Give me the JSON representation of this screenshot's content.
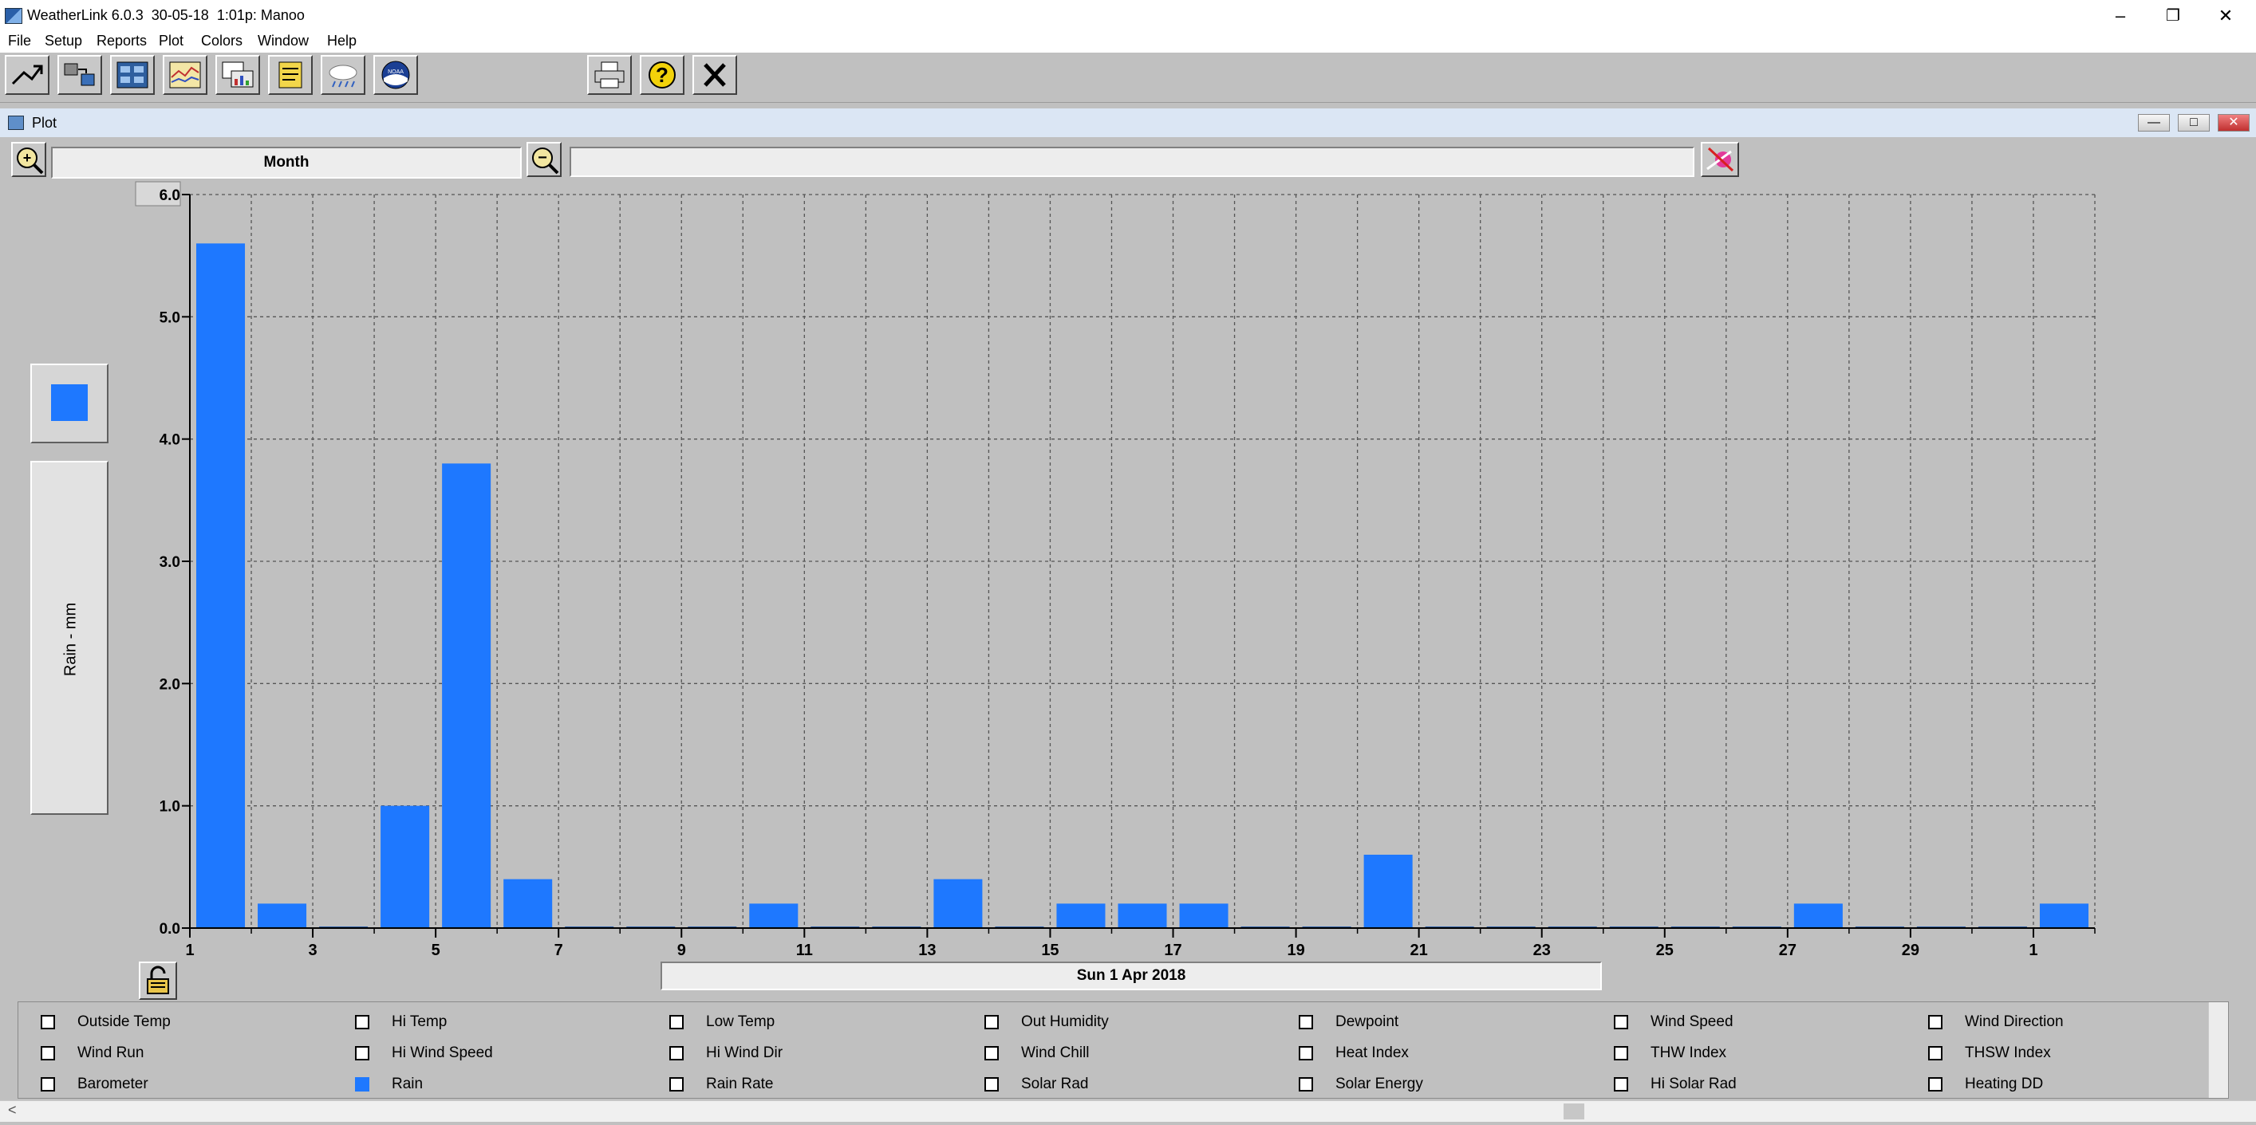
{
  "window": {
    "title": "WeatherLink 6.0.3  30-05-18  1:01p: Manoo",
    "minimize": "–",
    "restore": "❐",
    "close": "✕"
  },
  "menu": [
    "File",
    "Setup",
    "Reports",
    "Plot",
    "Colors",
    "Window",
    "Help"
  ],
  "toolbar": {
    "icons": [
      "station-icon",
      "transfer-icon",
      "bulletin-icon",
      "strip-chart-icon",
      "plot-icon",
      "notes-icon",
      "weather-icon",
      "noaa-icon",
      "print-icon",
      "help-icon",
      "close-icon"
    ],
    "noaa_text": "NOAA",
    "help_glyph": "?",
    "close_glyph": "✕"
  },
  "plot_window": {
    "title": "Plot",
    "controls": [
      "—",
      "□",
      "✕"
    ]
  },
  "plot_header": {
    "range_label": "Month",
    "zoom_in": "+",
    "zoom_out": "−"
  },
  "y_axis_box": {
    "label": "Rain - mm"
  },
  "date_label": "Sun 1 Apr 2018",
  "colors": {
    "bar": "#1e78ff",
    "background": "#c0c0c0"
  },
  "chart_data": {
    "type": "bar",
    "ylabel": "Rain - mm",
    "ylim": [
      0,
      6
    ],
    "yticks": [
      "0.0",
      "1.0",
      "2.0",
      "3.0",
      "4.0",
      "5.0",
      "6.0"
    ],
    "xtick_labels": [
      "1",
      "3",
      "5",
      "7",
      "9",
      "11",
      "13",
      "15",
      "17",
      "19",
      "21",
      "23",
      "25",
      "27",
      "29",
      "1"
    ],
    "categories": [
      "1",
      "2",
      "3",
      "4",
      "5",
      "6",
      "7",
      "8",
      "9",
      "10",
      "11",
      "12",
      "13",
      "14",
      "15",
      "16",
      "17",
      "18",
      "19",
      "20",
      "21",
      "22",
      "23",
      "24",
      "25",
      "26",
      "27",
      "28",
      "29",
      "30",
      "1"
    ],
    "values": [
      5.6,
      0.2,
      0,
      1.0,
      3.8,
      0.4,
      0,
      0,
      0,
      0.2,
      0,
      0,
      0.4,
      0,
      0.2,
      0.2,
      0.2,
      0,
      0,
      0.6,
      0,
      0,
      0,
      0,
      0,
      0,
      0.2,
      0,
      0,
      0,
      0.2
    ],
    "grid": true
  },
  "checkboxes": [
    [
      {
        "label": "Outside Temp",
        "checked": false
      },
      {
        "label": "Hi Temp",
        "checked": false
      },
      {
        "label": "Low Temp",
        "checked": false
      },
      {
        "label": "Out Humidity",
        "checked": false
      },
      {
        "label": "Dewpoint",
        "checked": false
      },
      {
        "label": "Wind Speed",
        "checked": false
      },
      {
        "label": "Wind Direction",
        "checked": false
      }
    ],
    [
      {
        "label": "Wind Run",
        "checked": false
      },
      {
        "label": "Hi Wind Speed",
        "checked": false
      },
      {
        "label": "Hi Wind Dir",
        "checked": false
      },
      {
        "label": "Wind Chill",
        "checked": false
      },
      {
        "label": "Heat Index",
        "checked": false
      },
      {
        "label": "THW Index",
        "checked": false
      },
      {
        "label": "THSW Index",
        "checked": false
      }
    ],
    [
      {
        "label": "Barometer",
        "checked": false
      },
      {
        "label": "Rain",
        "checked": true
      },
      {
        "label": "Rain Rate",
        "checked": false
      },
      {
        "label": "Solar Rad",
        "checked": false
      },
      {
        "label": "Solar Energy",
        "checked": false
      },
      {
        "label": "Hi Solar Rad",
        "checked": false
      },
      {
        "label": "Heating DD",
        "checked": false
      }
    ]
  ],
  "scrollbar": {
    "left_arrow": "<"
  }
}
